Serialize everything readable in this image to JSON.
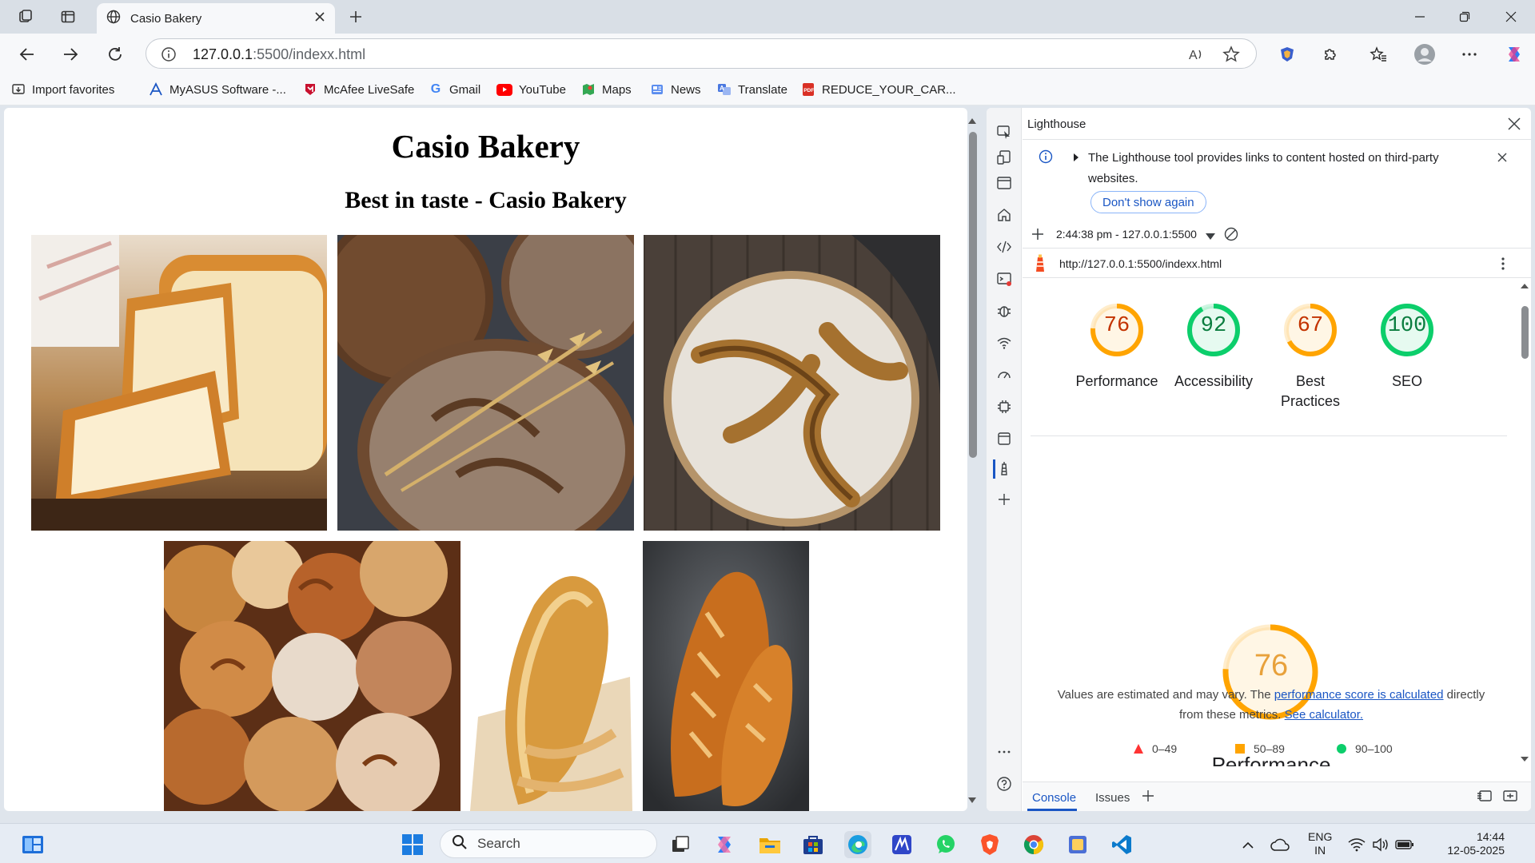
{
  "browser": {
    "tab_title": "Casio Bakery",
    "url_host": "127.0.0.1",
    "url_rest": ":5500/indexx.html",
    "favorites": [
      "Import favorites",
      "MyASUS Software -...",
      "McAfee LiveSafe",
      "Gmail",
      "YouTube",
      "Maps",
      "News",
      "Translate",
      "REDUCE_YOUR_CAR..."
    ]
  },
  "page": {
    "title": "Casio Bakery",
    "subtitle": "Best in taste - Casio Bakery"
  },
  "devtools": {
    "panel_title": "Lighthouse",
    "info_text": "The Lighthouse tool provides links to content hosted on third-party websites.",
    "dont_show_label": "Don't show again",
    "report_time": "2:44:38 pm - 127.0.0.1:5500",
    "report_url": "http://127.0.0.1:5500/indexx.html",
    "scores": [
      {
        "label": "Performance",
        "value": 76,
        "color": "#ffa400"
      },
      {
        "label": "Accessibility",
        "value": 92,
        "color": "#0cce6b"
      },
      {
        "label": "Best Practices",
        "value": 67,
        "color": "#ffa400"
      },
      {
        "label": "SEO",
        "value": 100,
        "color": "#0cce6b"
      }
    ],
    "big_gauge": {
      "value": "76",
      "label": "Performance"
    },
    "perf_note_1": "Values are estimated and may vary. The ",
    "perf_note_link1": "performance score is calculated",
    "perf_note_2": " directly from these metrics. ",
    "perf_note_link2": "See calculator.",
    "legend": [
      "0–49",
      "50–89",
      "90–100"
    ],
    "drawer_tabs": [
      "Console",
      "Issues"
    ]
  },
  "taskbar": {
    "search_placeholder": "Search",
    "lang_1": "ENG",
    "lang_2": "IN",
    "time": "14:44",
    "date": "12-05-2025"
  },
  "colors": {
    "fail": "#ff3333",
    "average": "#ffa400",
    "pass": "#0cce6b",
    "link": "#1a56c4"
  }
}
